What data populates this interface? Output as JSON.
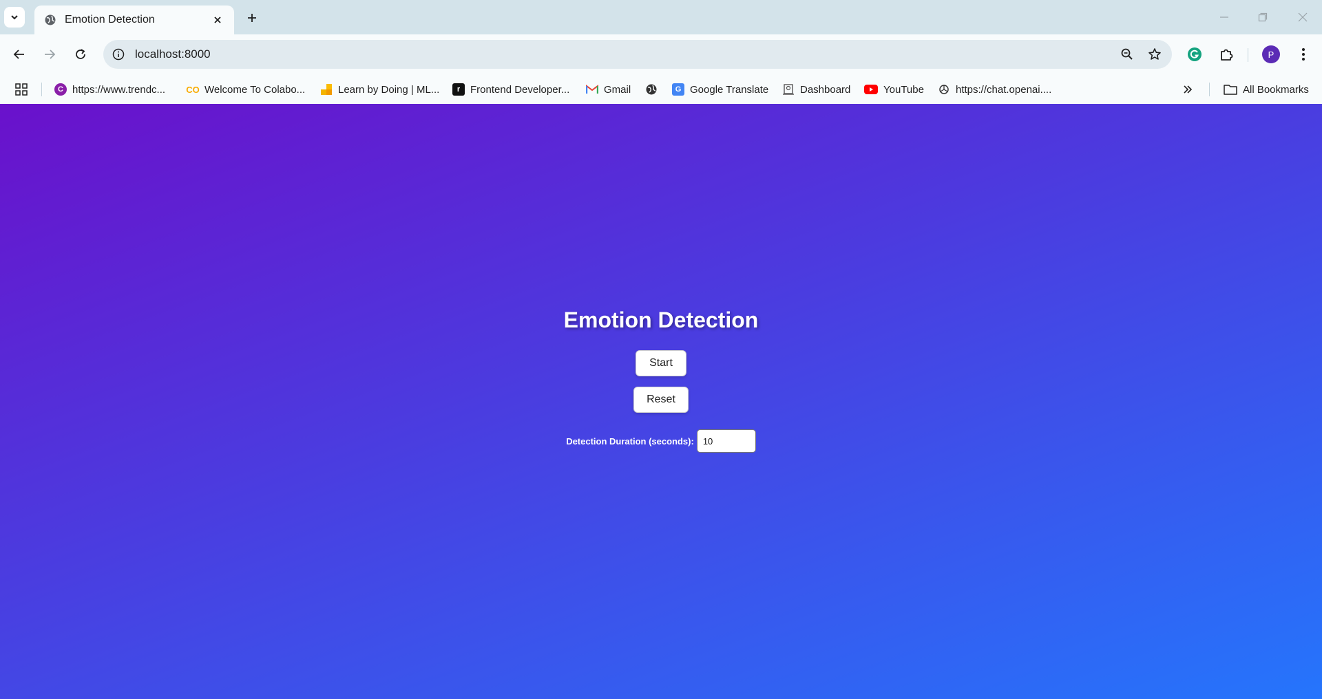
{
  "browser": {
    "tab": {
      "title": "Emotion Detection"
    },
    "address_bar": {
      "url": "localhost:8000"
    },
    "profile": {
      "initial": "P"
    },
    "bookmarks": [
      {
        "label": "https://www.trendc...",
        "icon": "trendc-icon",
        "color": "#8a1fa8"
      },
      {
        "label": "Welcome To Colabo...",
        "icon": "colab-icon",
        "color": "#f9ab00"
      },
      {
        "label": "Learn by Doing | ML...",
        "icon": "learn-icon",
        "color": "#f4b400"
      },
      {
        "label": "Frontend Developer...",
        "icon": "frontend-icon",
        "color": "#111111"
      },
      {
        "label": "Gmail",
        "icon": "gmail-icon",
        "color": "#ea4335"
      },
      {
        "label": "",
        "icon": "globe-icon",
        "color": "#333333"
      },
      {
        "label": "Google Translate",
        "icon": "translate-icon",
        "color": "#4285f4"
      },
      {
        "label": "Dashboard",
        "icon": "dashboard-icon",
        "color": "#555555"
      },
      {
        "label": "YouTube",
        "icon": "youtube-icon",
        "color": "#ff0000"
      },
      {
        "label": "https://chat.openai....",
        "icon": "openai-icon",
        "color": "#333333"
      }
    ],
    "all_bookmarks_label": "All Bookmarks"
  },
  "page": {
    "heading": "Emotion Detection",
    "start_label": "Start",
    "reset_label": "Reset",
    "duration_label": "Detection Duration (seconds):",
    "duration_value": "10"
  }
}
